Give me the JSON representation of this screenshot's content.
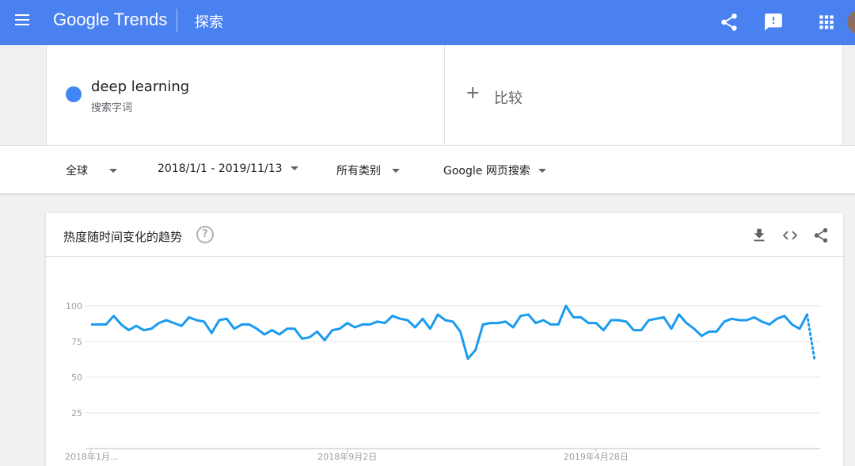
{
  "header": {
    "logo_google": "Google",
    "logo_trends": "Trends",
    "title": "探索",
    "bg_color": "#4a81f0"
  },
  "icons": {
    "menu": "menu-icon",
    "share": "share-icon",
    "feedback": "feedback-icon",
    "apps": "apps-grid-icon",
    "download": "download-icon",
    "embed": "embed-icon",
    "help": "help-icon"
  },
  "search": {
    "term": "deep learning",
    "term_type": "搜索字词",
    "term_color": "#4285f4",
    "compare_label": "比较",
    "compare_plus": "+"
  },
  "filters": {
    "region": "全球",
    "date_range": "2018/1/1 - 2019/11/13",
    "category": "所有类别",
    "search_type": "Google 网页搜索"
  },
  "chart_section": {
    "title": "热度随时间变化的趋势",
    "help_glyph": "?"
  },
  "chart_data": {
    "type": "line",
    "title": "热度随时间变化的趋势",
    "xlabel": "",
    "ylabel": "",
    "ylim": [
      0,
      100
    ],
    "yticks": [
      25,
      50,
      75,
      100
    ],
    "ytick_labels": [
      "25",
      "50",
      "75",
      "100"
    ],
    "xtick_labels": [
      "2018年1月...",
      "2018年9月2日",
      "2019年4月28日"
    ],
    "grid": true,
    "series": [
      {
        "name": "deep learning",
        "color": "#1a9bf0",
        "values": [
          87,
          87,
          87,
          93,
          87,
          83,
          86,
          83,
          84,
          88,
          90,
          88,
          86,
          92,
          90,
          89,
          81,
          90,
          91,
          84,
          87,
          87,
          84,
          80,
          83,
          80,
          84,
          84,
          77,
          78,
          82,
          76,
          83,
          84,
          88,
          85,
          87,
          87,
          89,
          88,
          93,
          91,
          90,
          85,
          91,
          84,
          94,
          90,
          89,
          82,
          63,
          69,
          87,
          88,
          88,
          89,
          85,
          93,
          94,
          88,
          90,
          87,
          87,
          100,
          92,
          92,
          88,
          88,
          83,
          90,
          90,
          89,
          83,
          83,
          90,
          91,
          92,
          84,
          94,
          88,
          84,
          79,
          82,
          82,
          89,
          91,
          90,
          90,
          92,
          89,
          87,
          91,
          93,
          87,
          84,
          94
        ],
        "partial_tail": [
          94,
          62
        ]
      }
    ]
  }
}
